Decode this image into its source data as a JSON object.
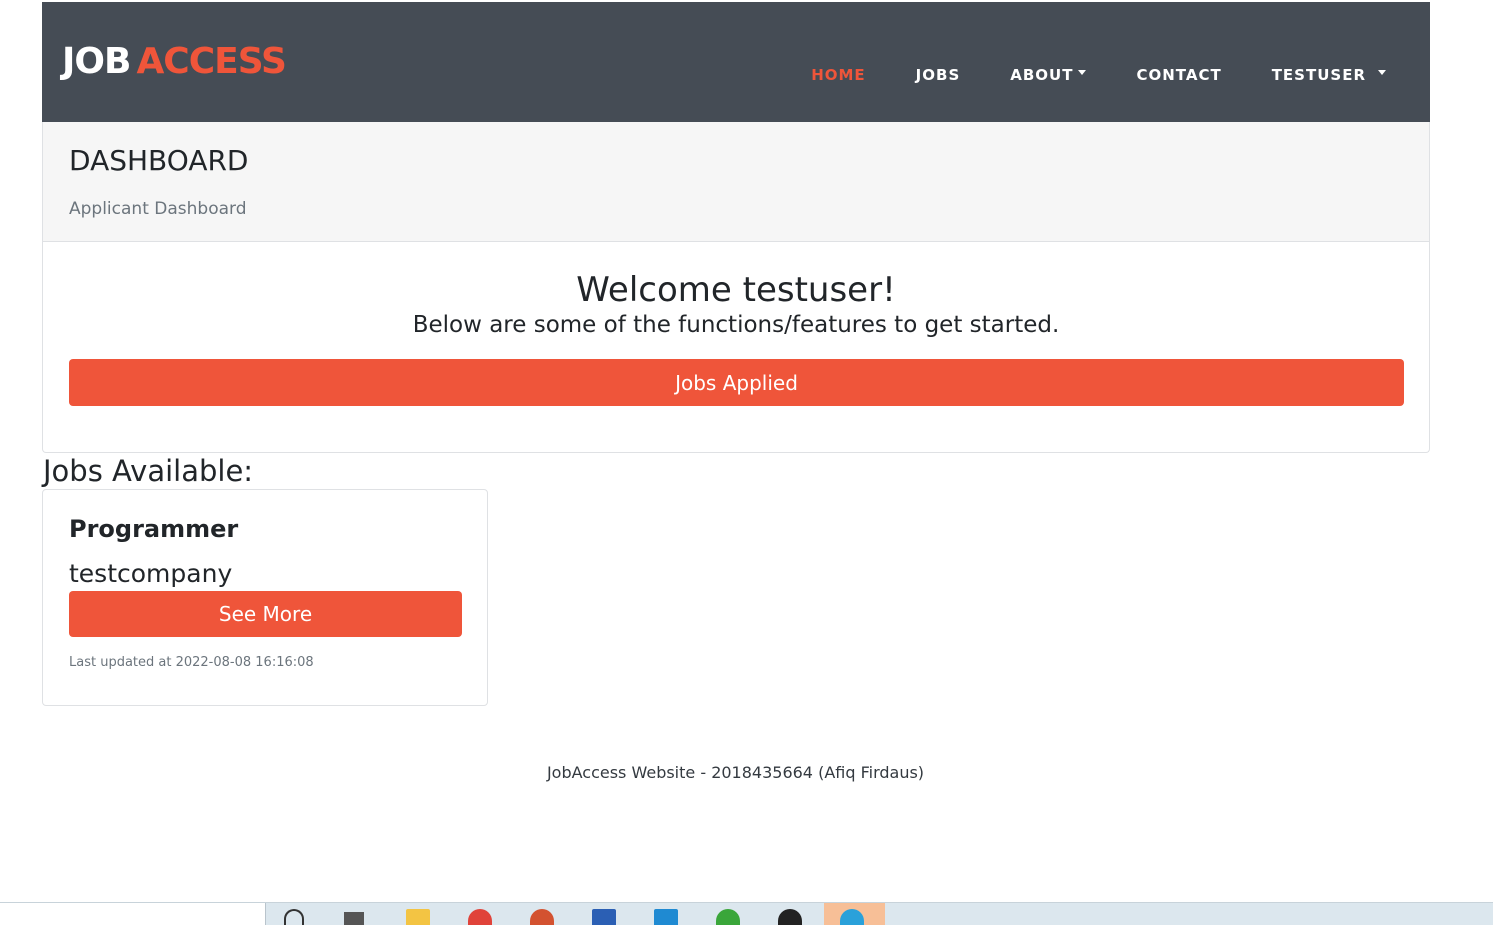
{
  "nav": {
    "brand_part1": "JOB",
    "brand_part2": "ACCESS",
    "links": [
      {
        "label": "HOME",
        "active": true
      },
      {
        "label": "JOBS"
      },
      {
        "label": "ABOUT"
      },
      {
        "label": "CONTACT"
      },
      {
        "label": "TESTUSER"
      }
    ]
  },
  "dashboard": {
    "title": "DASHBOARD",
    "subtitle": "Applicant Dashboard",
    "welcome": "Welcome testuser!",
    "welcome_sub": "Below are some of the functions/features to get started.",
    "jobs_applied_label": "Jobs Applied"
  },
  "jobs": {
    "heading": "Jobs Available:",
    "items": [
      {
        "title": "Programmer",
        "company": "testcompany",
        "see_more_label": "See More",
        "updated": "Last updated at 2022-08-08 16:16:08"
      }
    ]
  },
  "footer": {
    "text": "JobAccess Website - 2018435664 (Afiq Firdaus)"
  },
  "taskbar": {
    "icons": [
      "search-icon",
      "task-view-icon",
      "file-explorer-icon",
      "chrome-icon",
      "powerpoint-icon",
      "word-icon",
      "vscode-icon",
      "app-icon",
      "github-icon",
      "telegram-icon"
    ]
  },
  "colors": {
    "accent": "#ef553a",
    "navbar": "#454c55",
    "header_bg": "#f6f6f6"
  }
}
